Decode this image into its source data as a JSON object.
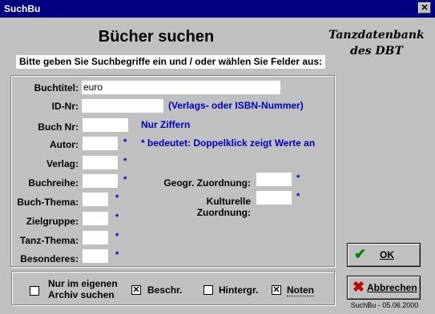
{
  "window": {
    "title": "SuchBu",
    "close_glyph": "✕"
  },
  "heading": "Bücher suchen",
  "brand": {
    "line1": "Tanzdatenbank",
    "line2": "des DBT"
  },
  "instructions": "Bitte geben Sie Suchbegriffe ein und / oder wählen Sie Felder aus:",
  "fields": {
    "buchtitel": {
      "label": "Buchtitel:",
      "value": "euro"
    },
    "idnr": {
      "label": "ID-Nr:",
      "value": "",
      "hint": "(Verlags- oder ISBN-Nummer)"
    },
    "buchnr": {
      "label": "Buch Nr:",
      "value": "",
      "hint": "Nur Ziffern"
    },
    "autor": {
      "label": "Autor:",
      "value": "",
      "hint": "* bedeutet: Doppelklick zeigt Werte an"
    },
    "verlag": {
      "label": "Verlag:",
      "value": ""
    },
    "buchreihe": {
      "label": "Buchreihe:",
      "value": ""
    },
    "buchthema": {
      "label": "Buch-Thema:",
      "value": ""
    },
    "zielgruppe": {
      "label": "Zielgruppe:",
      "value": ""
    },
    "tanzthema": {
      "label": "Tanz-Thema:",
      "value": ""
    },
    "besonderes": {
      "label": "Besonderes:",
      "value": ""
    },
    "geogr": {
      "label": "Geogr. Zuordnung:",
      "value": ""
    },
    "kulturell": {
      "label": "Kulturelle Zuordnung:",
      "value": ""
    }
  },
  "star": "*",
  "options": {
    "archiv": {
      "label_line1": "Nur im eigenen",
      "label_line2": "Archiv suchen",
      "checked": false
    },
    "beschr": {
      "label": "Beschr.",
      "checked": true
    },
    "hintergr": {
      "label": "Hintergr.",
      "checked": false
    },
    "noten": {
      "label": "Noten",
      "checked": true
    }
  },
  "check_glyph": "✕",
  "buttons": {
    "ok": {
      "label": "OK",
      "icon": "checkmark-icon",
      "color": "#008000"
    },
    "abbrechen": {
      "label": "Abbrechen",
      "icon": "cross-icon",
      "color": "#c00000"
    }
  },
  "footer": "SuchBu - 05.06.2000"
}
